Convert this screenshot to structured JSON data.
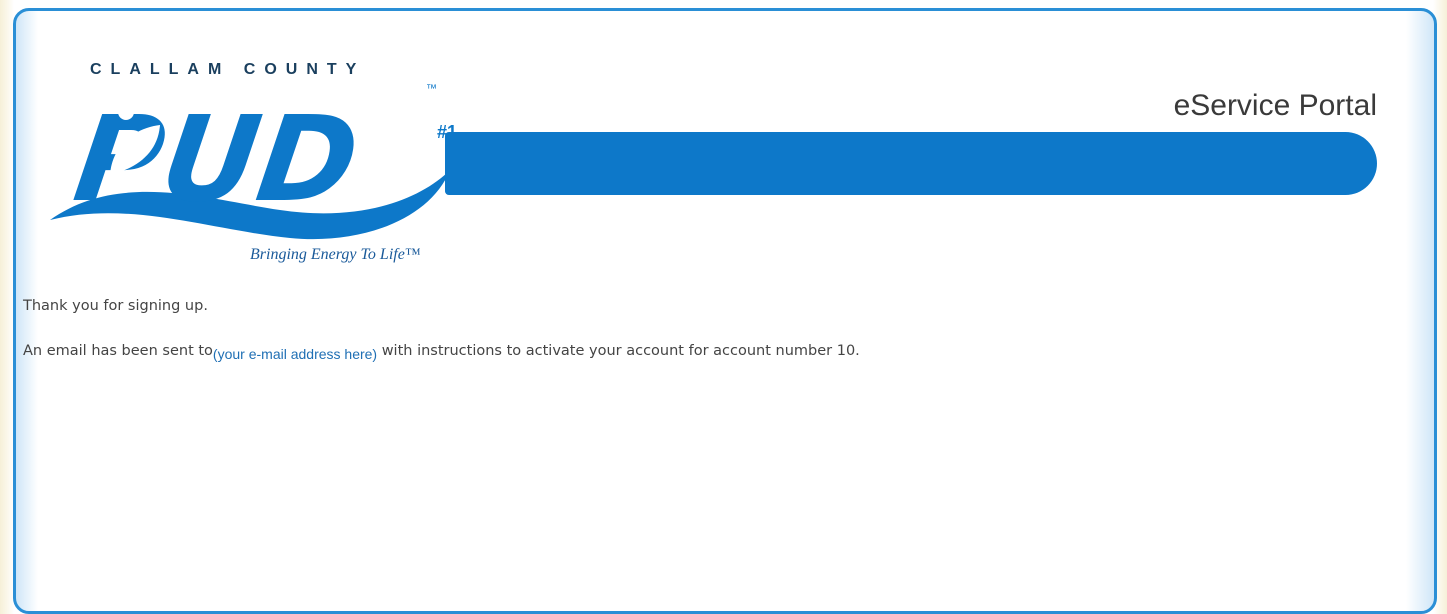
{
  "header": {
    "logo_top_text": "CLALLAM COUNTY",
    "logo_main_text": "PUD",
    "logo_number": "#1",
    "logo_trademark": "™",
    "tagline": "Bringing Energy To Life™",
    "portal_title": "eService Portal"
  },
  "message": {
    "line1": "Thank you for signing up.",
    "line2_prefix": "An email has been sent to",
    "email_placeholder": "(your e-mail address here)",
    "line2_suffix": " with instructions to activate your account for account number 10."
  },
  "colors": {
    "brand_blue": "#0d78c9",
    "frame_border": "#2a8fd6",
    "link": "#1f6fb4"
  }
}
